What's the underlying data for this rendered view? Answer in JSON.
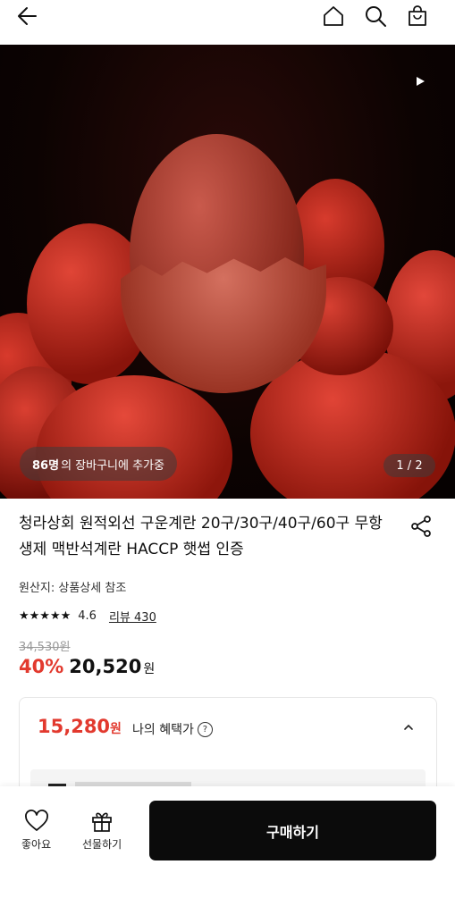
{
  "header": {
    "back": "back-arrow-icon",
    "home": "home-icon",
    "search": "search-icon",
    "cart": "shopping-bag-icon"
  },
  "hero": {
    "cart_count": "86명",
    "cart_text": "의 장바구니에 추가중",
    "pager": "1 / 2"
  },
  "product": {
    "title": "청라상회 원적외선 구운계란 20구/30구/40구/60구 무항생제 맥반석계란 HACCP 햇썹 인증",
    "origin": "원산지: 상품상세 참조",
    "stars": "★★★★★",
    "rating": "4.6",
    "reviews": "리뷰 430",
    "original_price": "34,530원",
    "discount": "40%",
    "price": "20,520",
    "price_unit": "원"
  },
  "benefit": {
    "price": "15,280",
    "unit": "원",
    "label": "나의 혜택가",
    "help": "?"
  },
  "bottom": {
    "like": "좋아요",
    "gift": "선물하기",
    "buy": "구매하기"
  },
  "colors": {
    "accent": "#e2392e",
    "buy_bg": "#0b0b0b"
  }
}
